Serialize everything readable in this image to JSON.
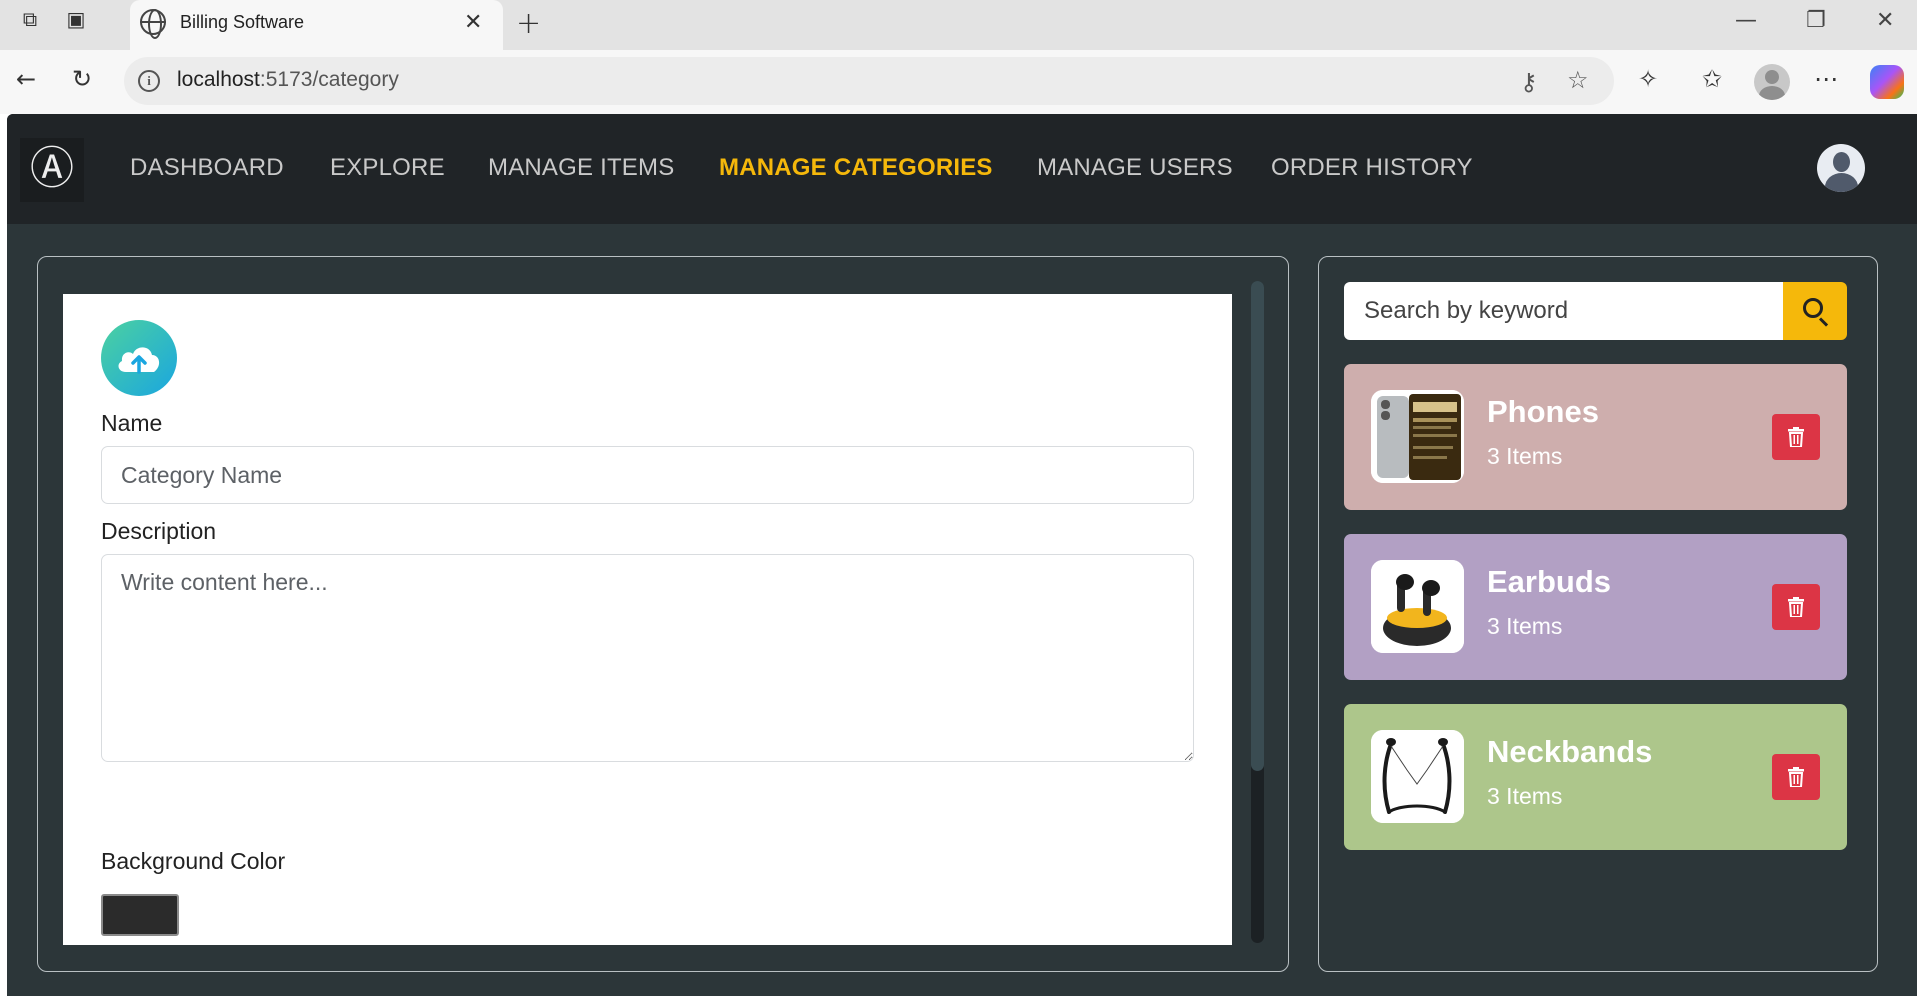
{
  "browser": {
    "tab_title": "Billing Software",
    "url_host": "localhost",
    "url_path": ":5173/category"
  },
  "nav": {
    "items": [
      {
        "label": "DASHBOARD",
        "active": false
      },
      {
        "label": "EXPLORE",
        "active": false
      },
      {
        "label": "MANAGE ITEMS",
        "active": false
      },
      {
        "label": "MANAGE CATEGORIES",
        "active": true
      },
      {
        "label": "MANAGE USERS",
        "active": false
      },
      {
        "label": "ORDER HISTORY",
        "active": false
      }
    ]
  },
  "form": {
    "name_label": "Name",
    "name_placeholder": "Category Name",
    "name_value": "",
    "description_label": "Description",
    "description_placeholder": "Write content here...",
    "description_value": "",
    "bg_color_label": "Background Color",
    "bg_color_value": "#2b2b2b"
  },
  "search": {
    "placeholder": "Search by keyword",
    "value": ""
  },
  "categories": [
    {
      "name": "Phones",
      "count": "3 Items",
      "bg_color": "#ceaead"
    },
    {
      "name": "Earbuds",
      "count": "3 Items",
      "bg_color": "#b2a0c4"
    },
    {
      "name": "Neckbands",
      "count": "3 Items",
      "bg_color": "#adc68b"
    }
  ],
  "theme": {
    "accent": "#f5b80b",
    "app_bg": "#2c3639",
    "navbar_bg": "#202427",
    "danger": "#dc3545"
  },
  "icons": {
    "logo": "anarchy-logo",
    "upload": "cloud-upload-icon",
    "search": "search-icon",
    "delete": "trash-icon"
  }
}
